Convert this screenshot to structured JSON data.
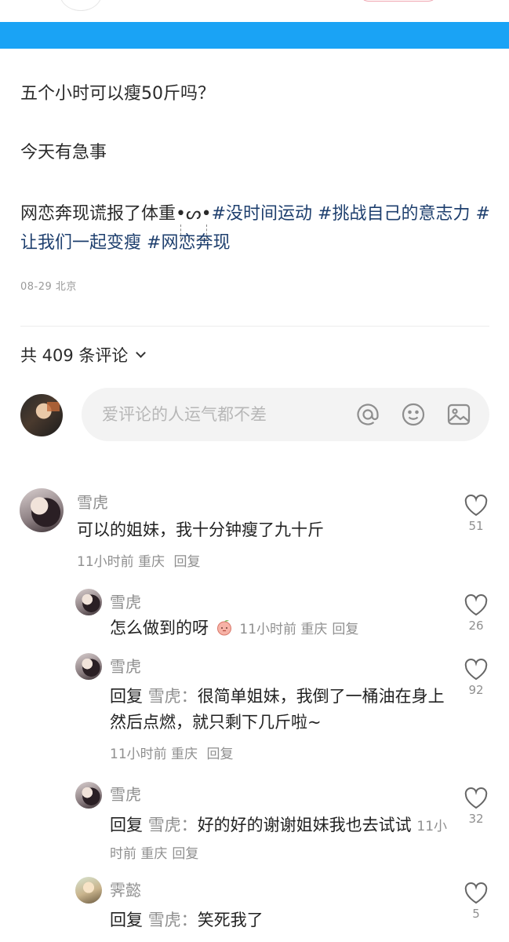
{
  "post": {
    "line1": "五个小时可以瘦50斤吗？",
    "line2": "今天有急事",
    "line3_text": "网恋奔现谎报了体重",
    "line3_emoticon": "•ᔕ•",
    "tags": [
      "#没时间运动",
      "#挑战自己的意志力",
      "#让我们一起变瘦",
      "#网恋奔现"
    ],
    "date": "08-29",
    "location": "北京"
  },
  "comments_header": {
    "label": "共 409 条评论"
  },
  "comment_input": {
    "placeholder": "爱评论的人运气都不差"
  },
  "comments": [
    {
      "name": "雪虎",
      "text": "可以的姐妹，我十分钟瘦了九十斤",
      "time": "11小时前",
      "location": "重庆",
      "reply": "回复",
      "likes": "51"
    },
    {
      "name": "雪虎",
      "text": "怎么做到的呀",
      "time": "11小时前",
      "location": "重庆",
      "reply": "回复",
      "likes": "26"
    },
    {
      "name": "雪虎",
      "reply_prefix": "回复",
      "reply_target": "雪虎：",
      "text": "很简单姐妹，我倒了一桶油在身上然后点燃，就只剩下几斤啦~",
      "time": "11小时前",
      "location": "重庆",
      "reply": "回复",
      "likes": "92"
    },
    {
      "name": "雪虎",
      "reply_prefix": "回复",
      "reply_target": "雪虎：",
      "text": "好的好的谢谢姐妹我也去试试",
      "time": "11小时前",
      "location": "重庆",
      "reply": "回复",
      "likes": "32"
    },
    {
      "name": "霁懿",
      "reply_prefix": "回复",
      "reply_target": "雪虎：",
      "text": "笑死我了",
      "likes": "5"
    }
  ],
  "colors": {
    "banner": "#1aa3f5",
    "hashtag": "#1e3f6e",
    "muted": "#8f8f8f"
  }
}
